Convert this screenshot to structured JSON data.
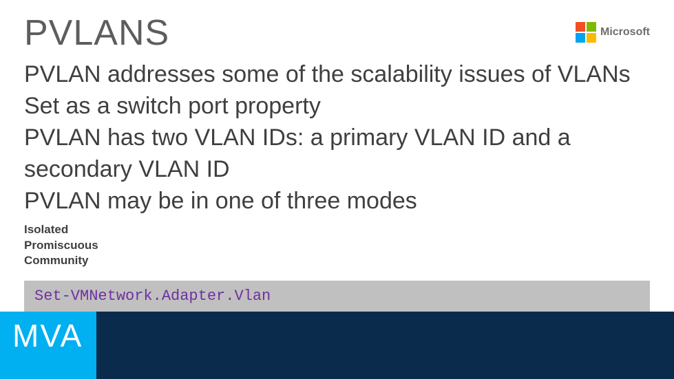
{
  "header": {
    "title": "PVLANS",
    "logo_text": "Microsoft"
  },
  "body": {
    "lines": [
      "PVLAN addresses some of the scalability issues of VLANs",
      "Set as a switch port property",
      "PVLAN has two VLAN IDs: a primary VLAN ID and a secondary VLAN ID",
      "PVLAN may be in one of three modes"
    ]
  },
  "modes": {
    "items": [
      "Isolated",
      "Promiscuous",
      "Community"
    ]
  },
  "code": {
    "command": "Set-VMNetwork.Adapter.Vlan"
  },
  "footer": {
    "mva": "MVA"
  }
}
